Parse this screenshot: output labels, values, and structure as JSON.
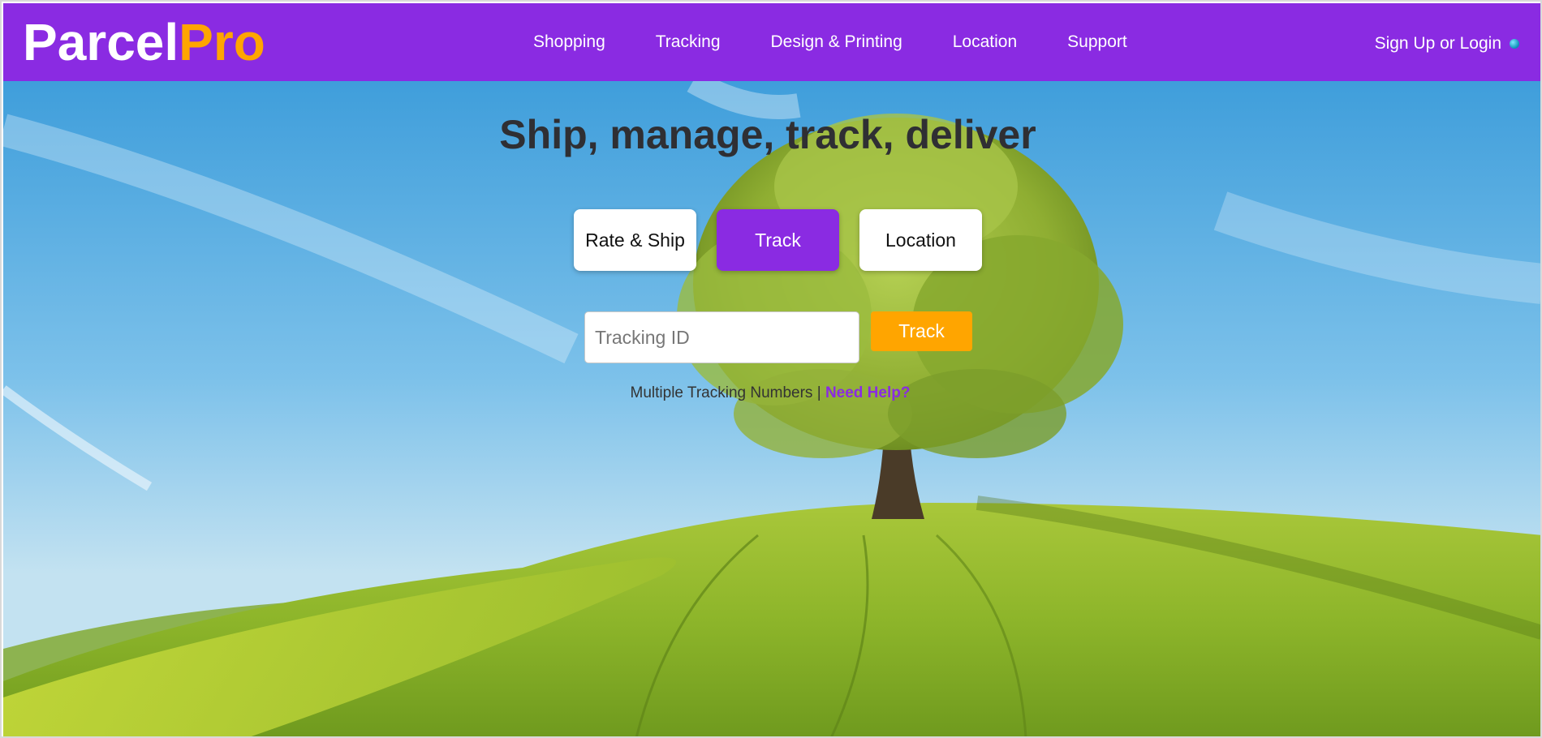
{
  "header": {
    "logo_part1": "Parcel",
    "logo_part2": "Pro",
    "nav": [
      "Shopping",
      "Tracking",
      "Design & Printing",
      "Location",
      "Support"
    ],
    "login_label": "Sign Up or Login",
    "login_icon": "globe-icon"
  },
  "hero": {
    "title": "Ship, manage, track, deliver",
    "tabs": [
      "Rate & Ship",
      "Track",
      "Location"
    ],
    "active_tab": "Track",
    "tracking_placeholder": "Tracking ID",
    "tracking_value": "",
    "track_button": "Track",
    "multiple_text": "Multiple Tracking Numbers",
    "separator": "|",
    "help_link": "Need Help?"
  },
  "colors": {
    "brand_purple": "#8a2be2",
    "accent_orange": "#ffa500"
  }
}
